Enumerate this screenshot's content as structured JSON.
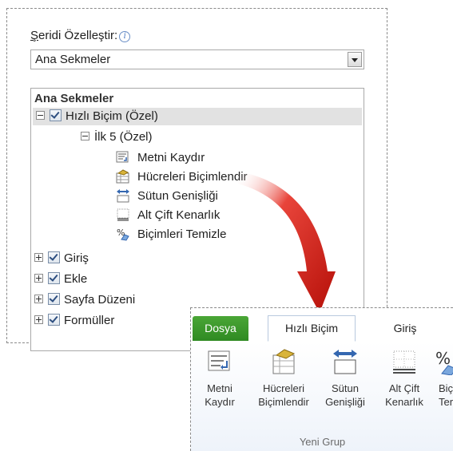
{
  "customize": {
    "label_underlined": "Ş",
    "label_rest": "eridi Özelleştir:",
    "info_icon": "i"
  },
  "dropdown": {
    "value": "Ana Sekmeler"
  },
  "tree": {
    "header": "Ana Sekmeler",
    "custom_tab": "Hızlı Biçim (Özel)",
    "custom_group": "İlk 5 (Özel)",
    "commands": [
      {
        "label": "Metni Kaydır",
        "icon": "wrap-text-icon"
      },
      {
        "label": "Hücreleri Biçimlendir",
        "icon": "format-cells-icon"
      },
      {
        "label": "Sütun Genişliği",
        "icon": "column-width-icon"
      },
      {
        "label": "Alt Çift Kenarlık",
        "icon": "bottom-double-border-icon"
      },
      {
        "label": "Biçimleri Temizle",
        "icon": "clear-formats-icon"
      }
    ],
    "tabs": [
      "Giriş",
      "Ekle",
      "Sayfa Düzeni",
      "Formüller"
    ]
  },
  "ribbon": {
    "tabs": {
      "file": "Dosya",
      "active": "Hızlı Biçim",
      "home": "Giriş"
    },
    "commands": [
      {
        "line1": "Metni",
        "line2": "Kaydır",
        "icon": "wrap-text-icon"
      },
      {
        "line1": "Hücreleri",
        "line2": "Biçimlendir",
        "icon": "format-cells-icon"
      },
      {
        "line1": "Sütun",
        "line2": "Genişliği",
        "icon": "column-width-icon"
      },
      {
        "line1": "Alt Çift",
        "line2": "Kenarlık",
        "icon": "bottom-double-border-icon"
      },
      {
        "line1": "Biç",
        "line2": "Ter",
        "icon": "clear-formats-icon"
      }
    ],
    "group_label": "Yeni Grup"
  },
  "colors": {
    "file_tab": "#3a9a2b",
    "arrow": "#c8150c",
    "selection": "#e2e2e2"
  }
}
